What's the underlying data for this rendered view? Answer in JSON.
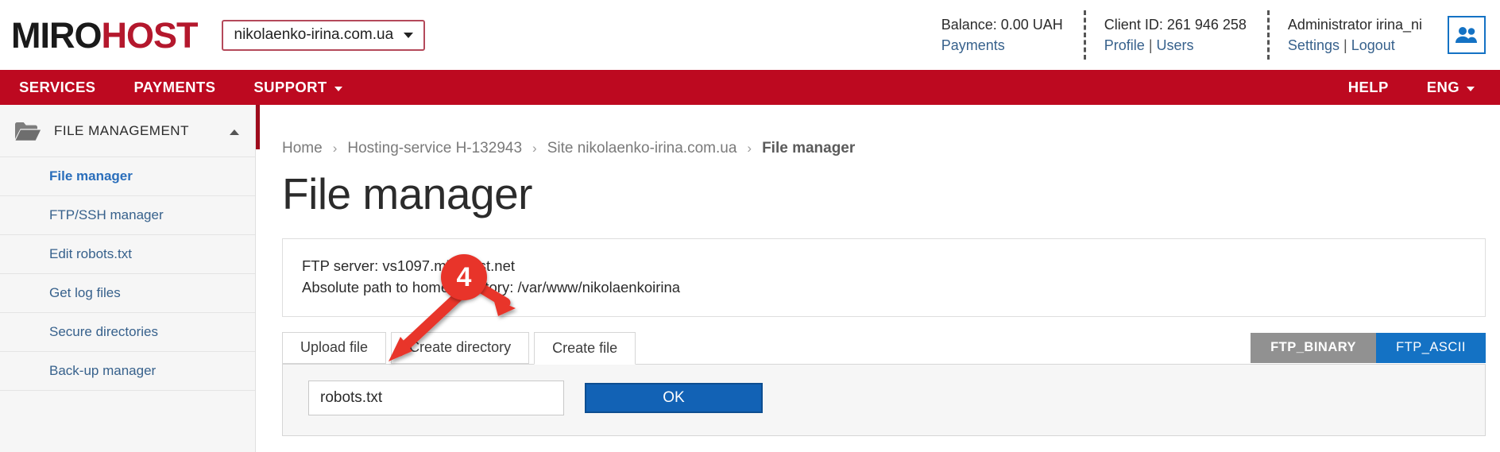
{
  "brand": {
    "name_part1": "MIRO",
    "name_part2": "HOST"
  },
  "domain_selector": {
    "value": "nikolaenko-irina.com.ua",
    "icon": "chevron-down-icon"
  },
  "header": {
    "balance": {
      "label": "Balance: 0.00 UAH",
      "link": "Payments"
    },
    "client": {
      "label": "Client ID: 261 946 258",
      "link_profile": "Profile",
      "separator": "|",
      "link_users": "Users"
    },
    "account": {
      "label": "Administrator irina_ni",
      "link_settings": "Settings",
      "separator": "|",
      "link_logout": "Logout"
    },
    "users_icon": "users-icon"
  },
  "nav": {
    "items": [
      {
        "label": "SERVICES",
        "has_caret": false
      },
      {
        "label": "PAYMENTS",
        "has_caret": false
      },
      {
        "label": "SUPPORT",
        "has_caret": true
      }
    ],
    "help": "HELP",
    "language": "ENG"
  },
  "sidebar": {
    "section_title": "FILE MANAGEMENT",
    "section_icon": "folder-icon",
    "collapse_icon": "chevron-up-icon",
    "items": [
      {
        "label": "File manager",
        "active": true
      },
      {
        "label": "FTP/SSH manager",
        "active": false
      },
      {
        "label": "Edit robots.txt",
        "active": false
      },
      {
        "label": "Get log files",
        "active": false
      },
      {
        "label": "Secure directories",
        "active": false
      },
      {
        "label": "Back-up manager",
        "active": false
      }
    ]
  },
  "breadcrumb": {
    "items": [
      "Home",
      "Hosting-service H-132943",
      "Site nikolaenko-irina.com.ua",
      "File manager"
    ],
    "separator": "›"
  },
  "page": {
    "title": "File manager"
  },
  "info_box": {
    "line1": "FTP server: vs1097.mirohost.net",
    "line2": "Absolute path to home directory: /var/www/nikolaenkoirina"
  },
  "tabs": [
    {
      "label": "Upload file",
      "active": false
    },
    {
      "label": "Create directory",
      "active": false
    },
    {
      "label": "Create file",
      "active": true
    }
  ],
  "transfer_mode": {
    "binary": "FTP_BINARY",
    "ascii": "FTP_ASCII"
  },
  "create_file_form": {
    "filename_value": "robots.txt",
    "filename_placeholder": "",
    "submit_label": "OK"
  },
  "annotation": {
    "step_number": "4"
  },
  "colors": {
    "brand_red": "#b4182d",
    "nav_red": "#bd0920",
    "link_blue": "#37618c",
    "accent_blue": "#1472c4",
    "annotation_red": "#e8342a",
    "binary_gray": "#919191"
  }
}
